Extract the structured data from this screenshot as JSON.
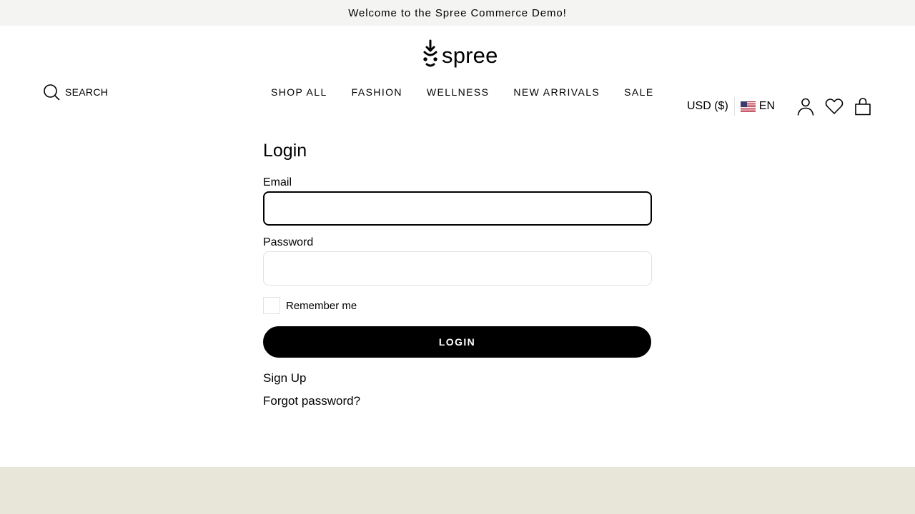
{
  "announcement": {
    "text": "Welcome to the Spree Commerce Demo!"
  },
  "header": {
    "logo": {
      "text": "spree",
      "icon": "spree-logo-mark"
    },
    "search": {
      "label": "SEARCH",
      "icon": "search-icon"
    },
    "nav": [
      {
        "label": "SHOP ALL"
      },
      {
        "label": "FASHION"
      },
      {
        "label": "WELLNESS"
      },
      {
        "label": "NEW ARRIVALS"
      },
      {
        "label": "SALE"
      }
    ],
    "currency": "USD ($)",
    "language": {
      "code": "EN",
      "flag": "us-flag-icon"
    },
    "icons": [
      "account-icon",
      "wishlist-heart-icon",
      "cart-bag-icon"
    ]
  },
  "login": {
    "title": "Login",
    "email": {
      "label": "Email",
      "value": "",
      "placeholder": ""
    },
    "password": {
      "label": "Password",
      "value": "",
      "placeholder": ""
    },
    "remember_me": {
      "label": "Remember me",
      "checked": false
    },
    "submit_label": "LOGIN",
    "signup_link": "Sign Up",
    "forgot_link": "Forgot password?"
  },
  "colors": {
    "announcement_bg": "#f4f4f2",
    "primary": "#000000",
    "button_text": "#ffffff",
    "border": "#e2e2e2",
    "footer_bg": "#e8e6d9"
  }
}
